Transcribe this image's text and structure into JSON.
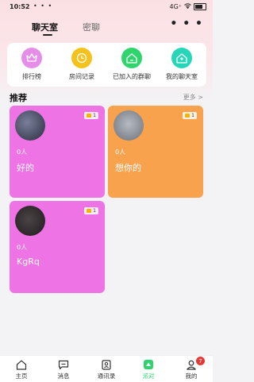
{
  "status_bar": {
    "time": "10:52",
    "dots": "• • •",
    "network": "4G⁺",
    "wifi": "WiFi",
    "battery_level": 0.7
  },
  "header": {
    "tabs": [
      {
        "label": "聊天室",
        "active": true
      },
      {
        "label": "密聊",
        "active": false
      }
    ],
    "more_icon": "more-dots-icon"
  },
  "quick_actions": [
    {
      "label": "排行榜",
      "icon": "crown-icon",
      "color": "#e58de8"
    },
    {
      "label": "房间记录",
      "icon": "clock-icon",
      "color": "#f5c21c"
    },
    {
      "label": "已加入的群聊",
      "icon": "home-icon",
      "color": "#2fd46d"
    },
    {
      "label": "我的聊天室",
      "icon": "home-icon",
      "color": "#27d5b8"
    }
  ],
  "section": {
    "title": "推荐",
    "more": "更多 >"
  },
  "rooms": [
    {
      "count": "0人",
      "name": "好的",
      "badge": "1",
      "bg": "#ee73e5"
    },
    {
      "count": "0人",
      "name": "想你的",
      "badge": "1",
      "bg": "#f9a24e"
    },
    {
      "count": "0人",
      "name": "KgRq",
      "badge": "1",
      "bg": "#ee73e5"
    }
  ],
  "bottom_nav": [
    {
      "label": "主页",
      "icon": "home-icon"
    },
    {
      "label": "消息",
      "icon": "message-icon"
    },
    {
      "label": "通讯录",
      "icon": "contacts-icon"
    },
    {
      "label": "派对",
      "icon": "party-icon",
      "active": true
    },
    {
      "label": "我的",
      "icon": "profile-icon",
      "badge": "7"
    }
  ]
}
